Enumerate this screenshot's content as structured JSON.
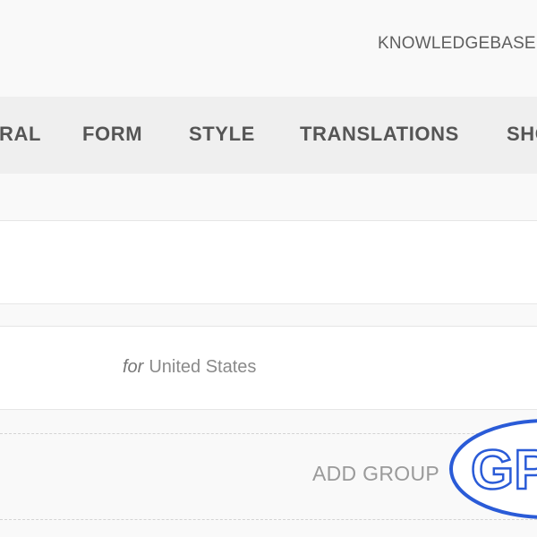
{
  "header": {
    "link_label": "KNOWLEDGEBASE"
  },
  "tabs": [
    {
      "label": "RAL"
    },
    {
      "label": "FORM"
    },
    {
      "label": "STYLE"
    },
    {
      "label": "TRANSLATIONS"
    },
    {
      "label": "SHO"
    }
  ],
  "region_row": {
    "prefix": "for",
    "country": "United States"
  },
  "actions": {
    "add_group_label": "ADD GROUP"
  },
  "logo": {
    "text": "GP",
    "color": "#2a5bd7"
  }
}
